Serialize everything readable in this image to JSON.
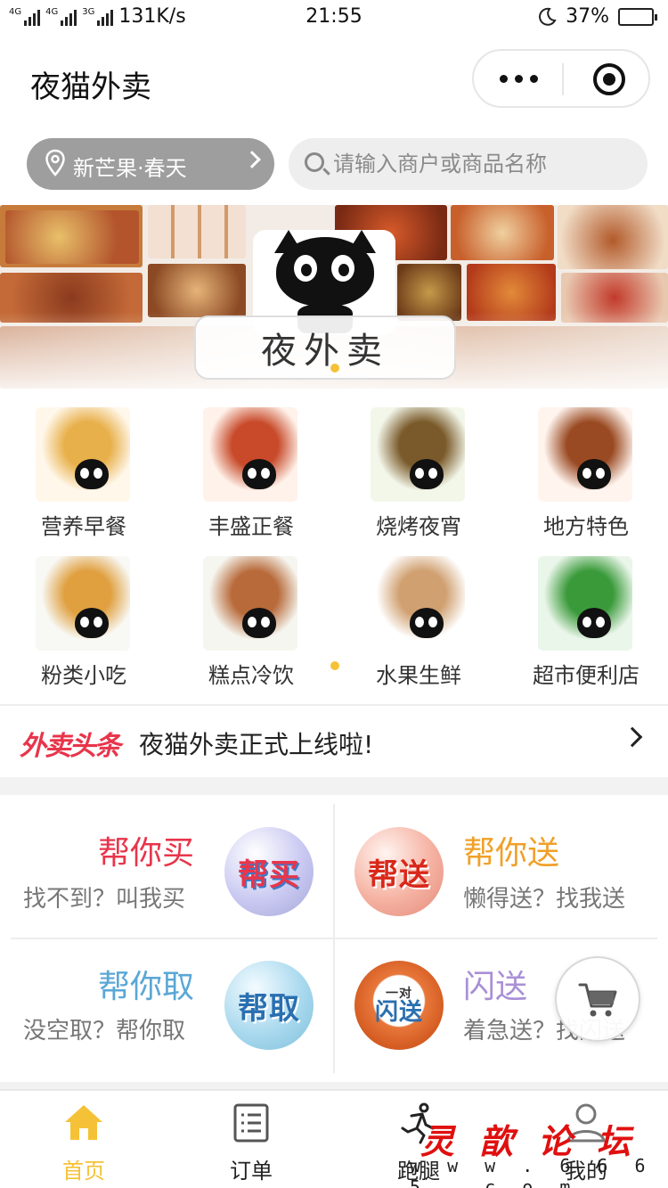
{
  "status_bar": {
    "network_left": "4G",
    "network_mid": "4G",
    "network_right": "3G",
    "speed": "131K/s",
    "time": "21:55",
    "battery": "37%",
    "battery_level": 0.37
  },
  "header": {
    "title": "夜猫外卖"
  },
  "location": {
    "label": "新芒果·春天"
  },
  "search": {
    "placeholder": "请输入商户或商品名称"
  },
  "banner": {
    "brand_text": "夜外卖",
    "slides": 1,
    "active_slide": 0
  },
  "categories": [
    {
      "label": "营养早餐",
      "icon": "breakfast-icon"
    },
    {
      "label": "丰盛正餐",
      "icon": "meal-icon"
    },
    {
      "label": "烧烤夜宵",
      "icon": "bbq-icon"
    },
    {
      "label": "地方特色",
      "icon": "local-dish-icon"
    },
    {
      "label": "粉类小吃",
      "icon": "noodles-icon"
    },
    {
      "label": "糕点冷饮",
      "icon": "drinks-icon"
    },
    {
      "label": "水果生鲜",
      "icon": "fruit-icon"
    },
    {
      "label": "超市便利店",
      "icon": "supermarket-icon"
    }
  ],
  "headline": {
    "tag": "外卖头条",
    "text": "夜猫外卖正式上线啦!"
  },
  "services": [
    {
      "title": "帮你买",
      "subtitle": "找不到？叫我买",
      "badge": "帮买",
      "title_color": "#e8354b"
    },
    {
      "title": "帮你送",
      "subtitle": "懒得送？找我送",
      "badge": "帮送",
      "title_color": "#f0a028"
    },
    {
      "title": "帮你取",
      "subtitle": "没空取？帮你取",
      "badge": "帮取",
      "title_color": "#5aa7d6"
    },
    {
      "title": "闪送",
      "subtitle": "着急送？找闪送",
      "badge": "闪送",
      "badge_top": "一对",
      "title_color": "#a98fd6"
    }
  ],
  "tabbar": [
    {
      "label": "首页",
      "icon": "home-icon",
      "active": true
    },
    {
      "label": "订单",
      "icon": "order-icon",
      "active": false
    },
    {
      "label": "跑腿",
      "icon": "runner-icon",
      "active": false
    },
    {
      "label": "我的",
      "icon": "profile-icon",
      "active": false
    }
  ],
  "watermark": {
    "title": "灵歆论坛",
    "url": "w w w . 6 6 6 5 . c o m"
  },
  "colors": {
    "accent": "#f5c237",
    "headline_red": "#e8354b",
    "location_pill": "#9e9e9e"
  }
}
